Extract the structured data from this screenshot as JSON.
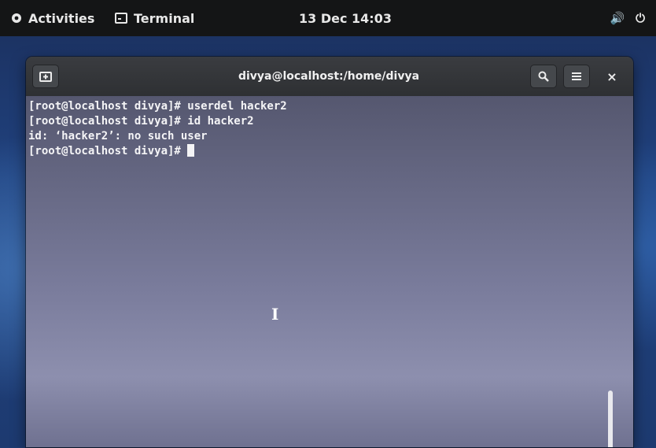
{
  "topbar": {
    "activities_label": "Activities",
    "app_label": "Terminal",
    "clock": "13 Dec 14:03",
    "volume_icon": "volume-icon",
    "power_icon": "power-icon"
  },
  "window": {
    "title": "divya@localhost:/home/divya",
    "new_tab_icon": "new-tab-icon",
    "search_icon": "search-icon",
    "menu_icon": "hamburger-menu-icon",
    "close_icon": "close-icon",
    "close_glyph": "×"
  },
  "terminal": {
    "lines": [
      "[root@localhost divya]# userdel hacker2",
      "[root@localhost divya]# id hacker2",
      "id: ‘hacker2’: no such user",
      "[root@localhost divya]# "
    ],
    "mouse_cursor": "I"
  }
}
